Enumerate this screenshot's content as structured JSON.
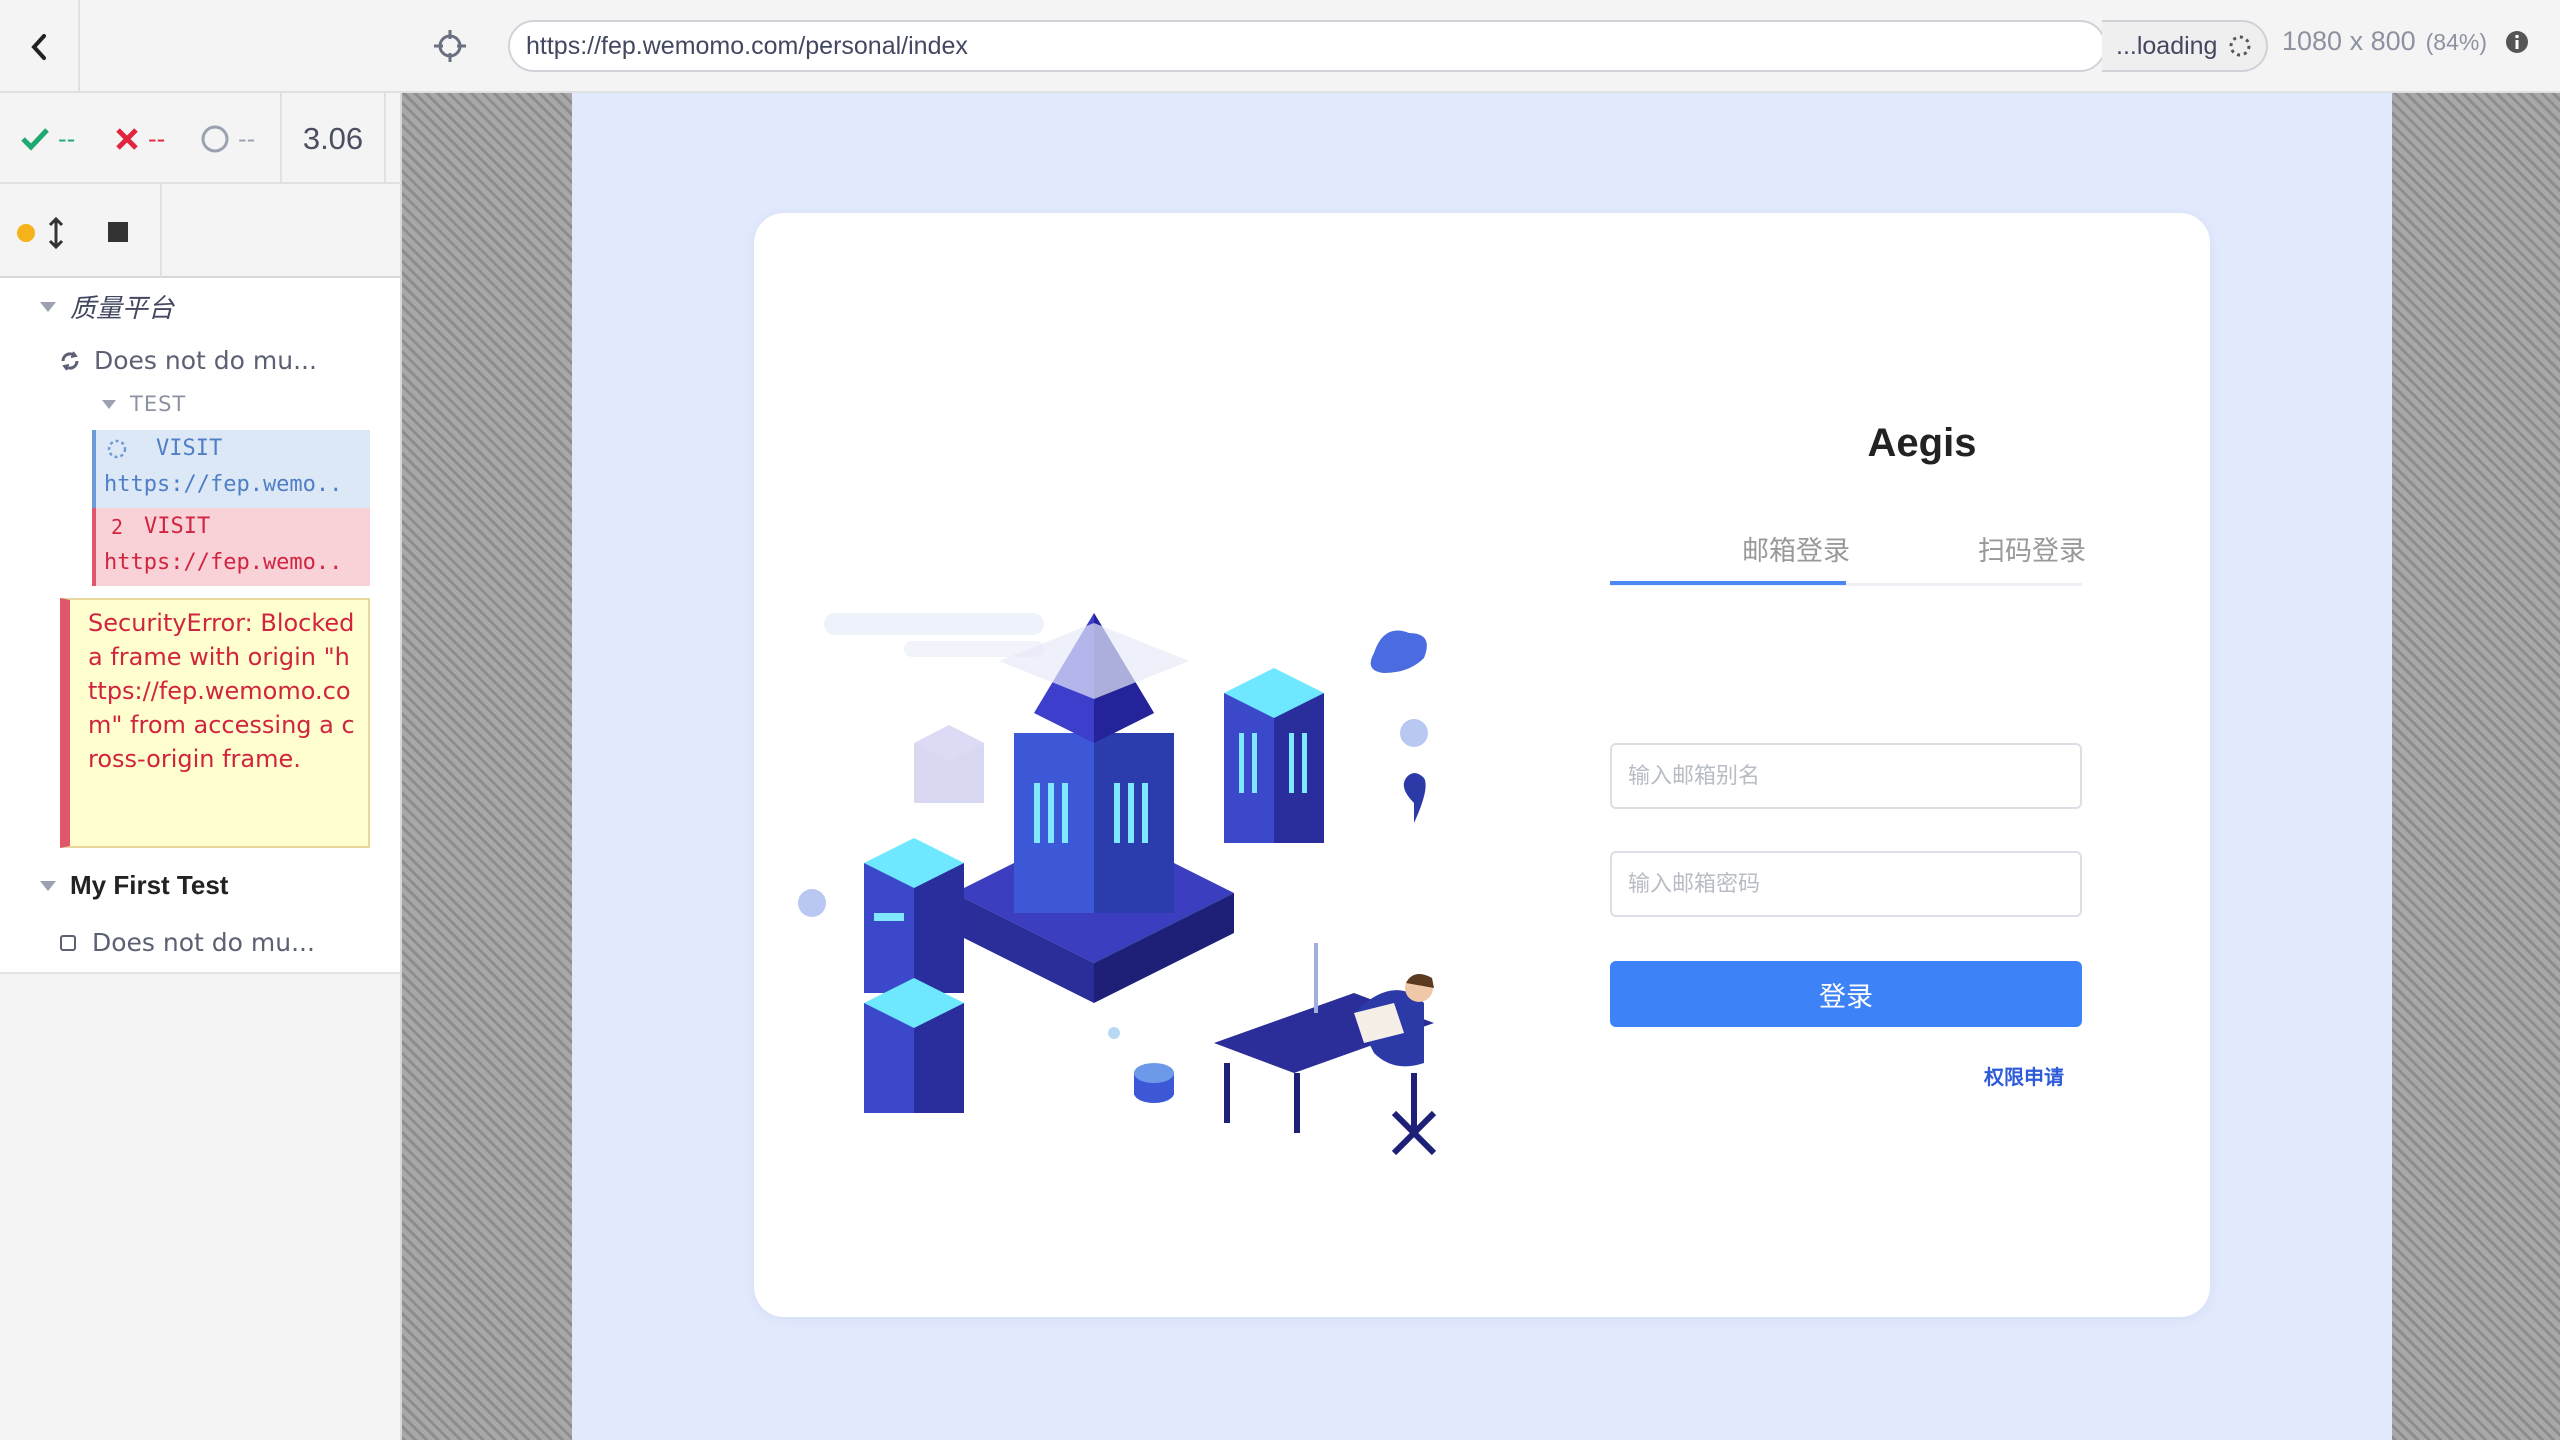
{
  "reporter": {
    "stats": {
      "passed": "--",
      "failed": "--",
      "pending": "--",
      "duration": "3.06"
    },
    "suites": [
      {
        "title": "质量平台",
        "tests": [
          {
            "title": "Does not do mu...",
            "hook": "TEST",
            "commands": [
              {
                "number": "",
                "name": "VISIT",
                "message": "https://fep.wemo..",
                "state": "pending"
              },
              {
                "number": "2",
                "name": "VISIT",
                "message": "https://fep.wemo..",
                "state": "failed"
              }
            ],
            "error": "SecurityError: Blocked a frame with origin \"https://fep.wemomo.com\" from accessing a cross-origin frame."
          }
        ]
      },
      {
        "title": "My First Test",
        "tests": [
          {
            "title": "Does not do mu..."
          }
        ]
      }
    ]
  },
  "topbar": {
    "url": "https://fep.wemomo.com/personal/index",
    "loading_label": "...loading",
    "viewport_size": "1080 x 800",
    "viewport_scale": "(84%)"
  },
  "app": {
    "title": "Aegis",
    "tabs": [
      "邮箱登录",
      "扫码登录"
    ],
    "email_placeholder": "输入邮箱别名",
    "password_placeholder": "输入邮箱密码",
    "login_label": "登录",
    "permission_link": "权限申请"
  },
  "icons": {
    "back": "chevron-left-icon",
    "selector": "crosshair-icon",
    "passed": "check-icon",
    "failed": "x-icon",
    "pending": "circle-icon",
    "auto_scroll": "arrows-vertical-icon",
    "stop": "stop-icon",
    "info": "info-icon",
    "loading": "spinner-icon"
  },
  "colors": {
    "passed": "#1fa971",
    "failed": "#e0263f",
    "running_dot": "#f6b21a",
    "app_background": "#e1e9fd",
    "primary": "#3e82f7"
  }
}
